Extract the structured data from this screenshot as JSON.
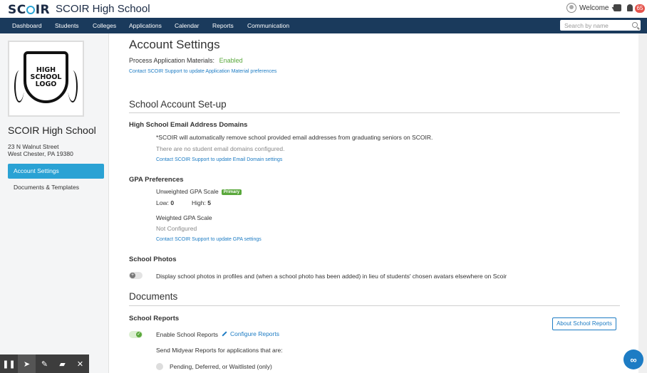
{
  "header": {
    "logo": "SCOIR",
    "school_name": "SCOIR High School",
    "welcome": "Welcome",
    "notification_count": "65"
  },
  "nav": {
    "items": [
      "Dashboard",
      "Students",
      "Colleges",
      "Applications",
      "Calendar",
      "Reports",
      "Communication"
    ],
    "search_placeholder": "Search by name"
  },
  "sidebar": {
    "logo_text": [
      "HIGH",
      "SCHOOL",
      "LOGO"
    ],
    "school_name": "SCOIR High School",
    "address_line1": "23 N Walnut Street",
    "address_line2": "West Chester, PA 19380",
    "menu": [
      "Account Settings",
      "Documents & Templates"
    ]
  },
  "main": {
    "title": "Account Settings",
    "pam_label": "Process Application Materials:",
    "pam_status": "Enabled",
    "pam_link": "Contact SCOIR Support to update Application Material preferences",
    "setup_title": "School Account Set-up",
    "email": {
      "title": "High School Email Address Domains",
      "note": "*SCOIR will automatically remove school provided email addresses from graduating seniors on SCOIR.",
      "empty": "There are no student email domains configured.",
      "link": "Contact SCOIR Support to update Email Domain settings"
    },
    "gpa": {
      "title": "GPA Preferences",
      "unweighted": "Unweighted GPA Scale",
      "primary": "Primary",
      "low_label": "Low:",
      "low_value": "0",
      "high_label": "High:",
      "high_value": "5",
      "weighted": "Weighted GPA Scale",
      "not_configured": "Not Configured",
      "link": "Contact SCOIR Support to update GPA settings"
    },
    "photos": {
      "title": "School Photos",
      "description": "Display school photos in profiles and (when a school photo has been added) in lieu of students' chosen avatars elsewhere on Scoir",
      "enabled": false
    },
    "documents_title": "Documents",
    "reports": {
      "title": "School Reports",
      "enable_label": "Enable School Reports",
      "enabled": true,
      "configure": "Configure Reports",
      "about_button": "About School Reports",
      "midyear_prompt": "Send Midyear Reports for applications that are:",
      "option1": "Pending, Deferred, or Waitlisted (only)"
    }
  },
  "colors": {
    "nav_bg": "#1a3a5c",
    "accent": "#2aa2d4",
    "link": "#1d7cc4",
    "success": "#5aa83c",
    "badge": "#e5534b"
  }
}
